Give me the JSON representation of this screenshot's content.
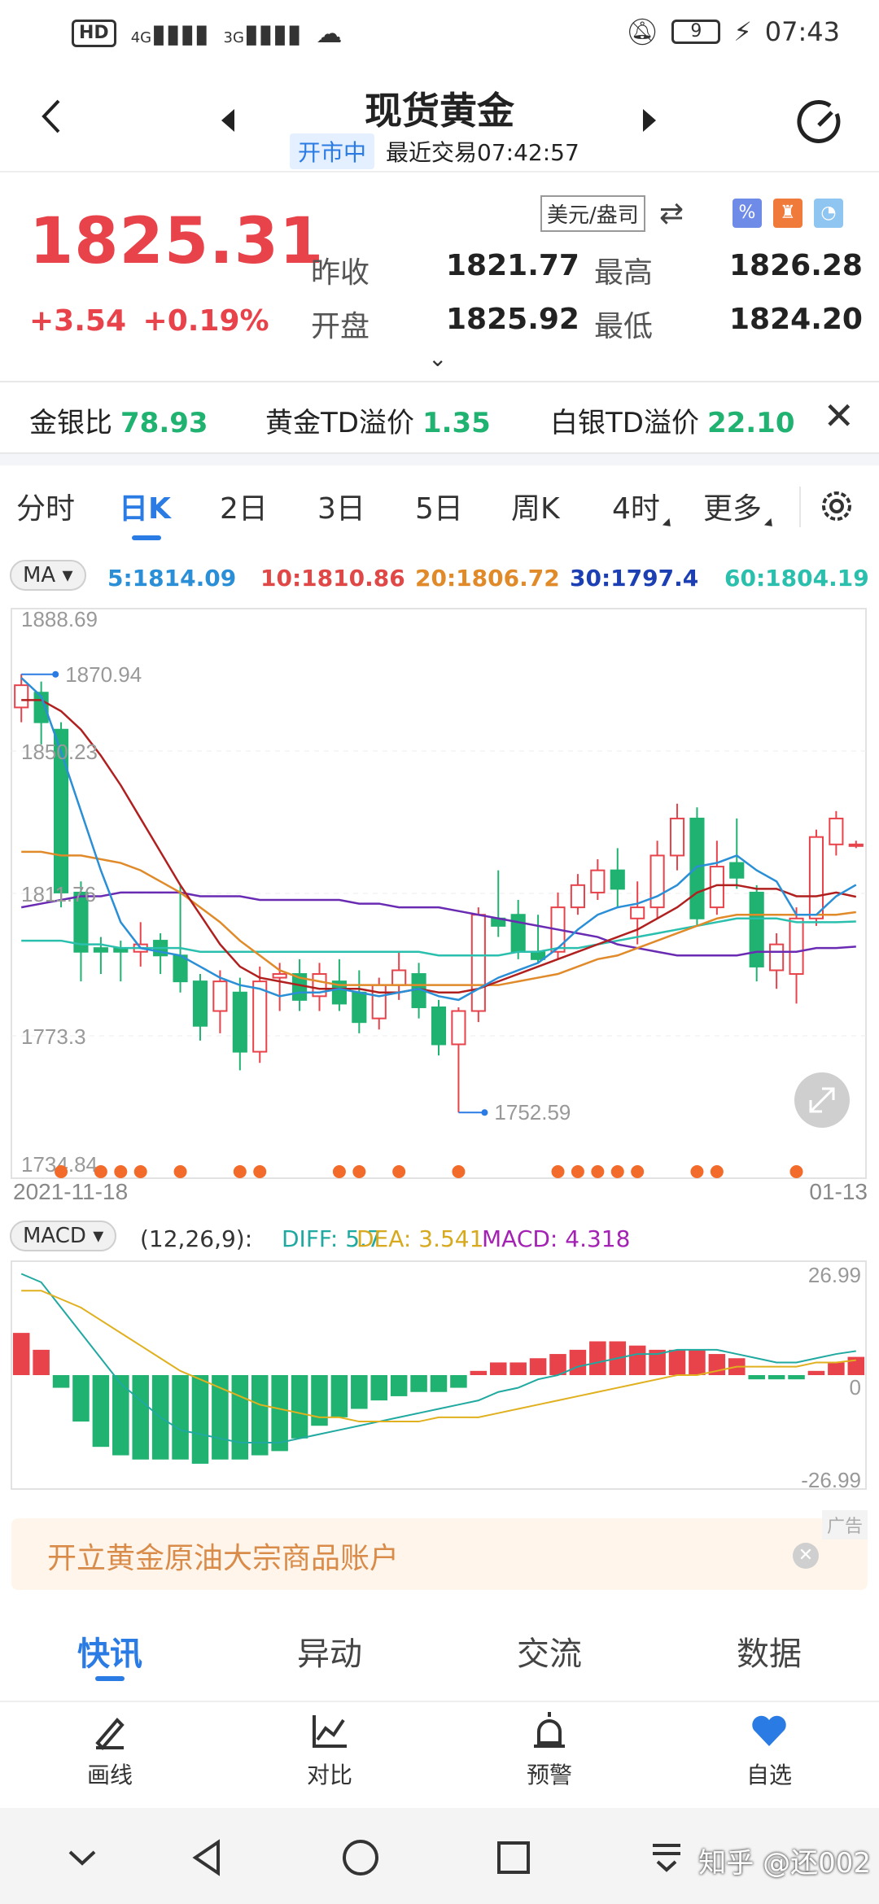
{
  "status": {
    "time": "07:43",
    "battery": "9",
    "net1": "4G",
    "net2": "3G",
    "hd": "HD"
  },
  "header": {
    "title": "现货黄金",
    "status_badge": "开市中",
    "last_trade": "最近交易07:42:57"
  },
  "quote": {
    "price": "1825.31",
    "change": "+3.54",
    "change_pct": "+0.19%",
    "prev_close_label": "昨收",
    "prev_close": "1821.77",
    "open_label": "开盘",
    "open": "1825.92",
    "high_label": "最高",
    "high": "1826.28",
    "low_label": "最低",
    "low": "1824.20",
    "unit": "美元/盎司"
  },
  "spreads": [
    {
      "label": "金银比",
      "value": "78.93"
    },
    {
      "label": "黄金TD溢价",
      "value": "1.35"
    },
    {
      "label": "白银TD溢价",
      "value": "22.10"
    }
  ],
  "tabs": [
    "分时",
    "日K",
    "2日",
    "3日",
    "5日",
    "周K",
    "4时",
    "更多"
  ],
  "active_tab": "日K",
  "ma_legend": {
    "selector": "MA",
    "ma5": "5:1814.09",
    "ma10": "10:1810.86",
    "ma20": "20:1806.72",
    "ma30": "30:1797.4",
    "ma60": "60:1804.19"
  },
  "colors": {
    "up": "#e8424a",
    "down": "#1fb270",
    "ma5": "#2a8fd6",
    "ma10": "#b0201f",
    "ma20": "#e08a2a",
    "ma30": "#6a2bb3",
    "ma60": "#2bbfae",
    "accent": "#2a7be4"
  },
  "chart_data": [
    {
      "type": "candlestick",
      "title": "",
      "ylim": [
        1734.84,
        1888.69
      ],
      "y_ticks": [
        "1888.69",
        "1850.23",
        "1811.76",
        "1773.3",
        "1734.84"
      ],
      "x_start": "2021-11-18",
      "x_end": "01-13",
      "max_label": "1870.94",
      "min_label": "1752.59",
      "candles": [
        {
          "o": 1862,
          "c": 1868,
          "h": 1871,
          "l": 1858
        },
        {
          "o": 1866,
          "c": 1858,
          "h": 1869,
          "l": 1852
        },
        {
          "o": 1856,
          "c": 1812,
          "h": 1858,
          "l": 1808
        },
        {
          "o": 1812,
          "c": 1796,
          "h": 1815,
          "l": 1788
        },
        {
          "o": 1797,
          "c": 1796,
          "h": 1800,
          "l": 1790
        },
        {
          "o": 1797,
          "c": 1796,
          "h": 1799,
          "l": 1788
        },
        {
          "o": 1796,
          "c": 1798,
          "h": 1804,
          "l": 1792
        },
        {
          "o": 1799,
          "c": 1795,
          "h": 1801,
          "l": 1790
        },
        {
          "o": 1795,
          "c": 1788,
          "h": 1814,
          "l": 1785
        },
        {
          "o": 1788,
          "c": 1776,
          "h": 1790,
          "l": 1772
        },
        {
          "o": 1780,
          "c": 1788,
          "h": 1791,
          "l": 1774
        },
        {
          "o": 1785,
          "c": 1769,
          "h": 1789,
          "l": 1764
        },
        {
          "o": 1769,
          "c": 1788,
          "h": 1792,
          "l": 1766
        },
        {
          "o": 1789,
          "c": 1790,
          "h": 1793,
          "l": 1780
        },
        {
          "o": 1790,
          "c": 1783,
          "h": 1794,
          "l": 1780
        },
        {
          "o": 1784,
          "c": 1790,
          "h": 1793,
          "l": 1780
        },
        {
          "o": 1788,
          "c": 1782,
          "h": 1794,
          "l": 1780
        },
        {
          "o": 1785,
          "c": 1777,
          "h": 1791,
          "l": 1774
        },
        {
          "o": 1778,
          "c": 1787,
          "h": 1789,
          "l": 1775
        },
        {
          "o": 1787,
          "c": 1791,
          "h": 1796,
          "l": 1783
        },
        {
          "o": 1790,
          "c": 1781,
          "h": 1793,
          "l": 1778
        },
        {
          "o": 1781,
          "c": 1771,
          "h": 1783,
          "l": 1768
        },
        {
          "o": 1771,
          "c": 1780,
          "h": 1781,
          "l": 1752.59
        },
        {
          "o": 1780,
          "c": 1806,
          "h": 1808,
          "l": 1777
        },
        {
          "o": 1805,
          "c": 1803,
          "h": 1818,
          "l": 1800
        },
        {
          "o": 1806,
          "c": 1796,
          "h": 1810,
          "l": 1794
        },
        {
          "o": 1796,
          "c": 1794,
          "h": 1806,
          "l": 1793
        },
        {
          "o": 1796,
          "c": 1808,
          "h": 1812,
          "l": 1794
        },
        {
          "o": 1808,
          "c": 1814,
          "h": 1817,
          "l": 1806
        },
        {
          "o": 1812,
          "c": 1818,
          "h": 1821,
          "l": 1810
        },
        {
          "o": 1818,
          "c": 1813,
          "h": 1824,
          "l": 1808
        },
        {
          "o": 1805,
          "c": 1808,
          "h": 1815,
          "l": 1798
        },
        {
          "o": 1808,
          "c": 1822,
          "h": 1826,
          "l": 1805
        },
        {
          "o": 1822,
          "c": 1832,
          "h": 1836,
          "l": 1818
        },
        {
          "o": 1832,
          "c": 1805,
          "h": 1835,
          "l": 1803
        },
        {
          "o": 1808,
          "c": 1819,
          "h": 1826,
          "l": 1806
        },
        {
          "o": 1820,
          "c": 1816,
          "h": 1832,
          "l": 1813
        },
        {
          "o": 1812,
          "c": 1792,
          "h": 1814,
          "l": 1788
        },
        {
          "o": 1791,
          "c": 1798,
          "h": 1801,
          "l": 1786
        },
        {
          "o": 1790,
          "c": 1805,
          "h": 1808,
          "l": 1782
        },
        {
          "o": 1805,
          "c": 1827,
          "h": 1829,
          "l": 1803
        },
        {
          "o": 1825,
          "c": 1832,
          "h": 1834,
          "l": 1822
        },
        {
          "o": 1825,
          "c": 1825,
          "h": 1826,
          "l": 1824
        }
      ],
      "ma_series": {
        "ma5": [
          1870,
          1865,
          1850,
          1834,
          1818,
          1804,
          1797,
          1796,
          1795,
          1792,
          1789,
          1787,
          1786,
          1784,
          1785,
          1785,
          1786,
          1785,
          1784,
          1785,
          1786,
          1784,
          1783,
          1786,
          1789,
          1791,
          1793,
          1797,
          1802,
          1806,
          1808,
          1809,
          1811,
          1814,
          1819,
          1820,
          1822,
          1818,
          1815,
          1806,
          1806,
          1811,
          1814.09
        ],
        "ma10": [
          1864,
          1864,
          1861,
          1856,
          1849,
          1841,
          1832,
          1823,
          1814,
          1806,
          1798,
          1792,
          1789,
          1788,
          1787,
          1786,
          1786,
          1786,
          1785,
          1785,
          1786,
          1785,
          1785,
          1786,
          1788,
          1790,
          1792,
          1794,
          1796,
          1798,
          1800,
          1802,
          1805,
          1808,
          1812,
          1814,
          1814,
          1813,
          1813,
          1811,
          1811,
          1812,
          1810.86
        ],
        "ma20": [
          1823,
          1823,
          1822,
          1822,
          1821,
          1820,
          1818,
          1815,
          1812,
          1808,
          1804,
          1799,
          1795,
          1791,
          1789,
          1788,
          1787,
          1787,
          1787,
          1787,
          1787,
          1787,
          1787,
          1787,
          1787,
          1788,
          1789,
          1790,
          1792,
          1794,
          1795,
          1797,
          1799,
          1801,
          1803,
          1805,
          1806,
          1806,
          1806,
          1806,
          1806,
          1806,
          1806.72
        ],
        "ma30": [
          1808,
          1809,
          1810,
          1811,
          1811,
          1812,
          1812,
          1812,
          1812,
          1811,
          1811,
          1811,
          1810,
          1810,
          1810,
          1810,
          1810,
          1809,
          1809,
          1808,
          1808,
          1808,
          1807,
          1806,
          1805,
          1804,
          1803,
          1802,
          1801,
          1800,
          1798,
          1797,
          1796,
          1795,
          1795,
          1795,
          1795,
          1796,
          1796,
          1796,
          1797,
          1797,
          1797.4
        ],
        "ma60": [
          1799,
          1799,
          1799,
          1798,
          1798,
          1797,
          1797,
          1797,
          1797,
          1796,
          1796,
          1796,
          1796,
          1796,
          1796,
          1796,
          1796,
          1796,
          1796,
          1796,
          1796,
          1795,
          1795,
          1795,
          1795,
          1796,
          1796,
          1797,
          1797,
          1798,
          1799,
          1800,
          1801,
          1802,
          1803,
          1804,
          1805,
          1805,
          1805,
          1804,
          1804,
          1804,
          1804.19
        ]
      },
      "event_markers": [
        2,
        4,
        5,
        6,
        8,
        11,
        12,
        16,
        17,
        19,
        22,
        27,
        28,
        29,
        30,
        31,
        34,
        35,
        39
      ]
    },
    {
      "type": "bar",
      "title": "MACD",
      "params": "(12,26,9):",
      "ylim": [
        -26.99,
        26.99
      ],
      "y_ticks": [
        "26.99",
        "0",
        "-26.99"
      ],
      "diff_label": "DIFF: 5.7",
      "dea_label": "DEA: 3.541",
      "macd_label": "MACD: 4.318",
      "histogram": [
        10,
        6,
        -3,
        -11,
        -17,
        -19,
        -20,
        -20,
        -20,
        -21,
        -20,
        -20,
        -19,
        -18,
        -15,
        -12,
        -10,
        -8,
        -6,
        -5,
        -4,
        -4,
        -3,
        1,
        3,
        3,
        4,
        5,
        6,
        8,
        8,
        7,
        6,
        6,
        6,
        5,
        4,
        -1,
        -1,
        -1,
        1,
        3,
        4.318
      ],
      "diff": [
        24,
        22,
        16,
        10,
        4,
        -2,
        -6,
        -10,
        -13,
        -14,
        -15,
        -16,
        -16,
        -16,
        -15,
        -14,
        -13,
        -12,
        -11,
        -10,
        -9,
        -8,
        -7,
        -6,
        -4,
        -3,
        -1,
        0,
        2,
        3,
        4,
        5,
        5,
        6,
        6,
        6,
        5,
        4,
        3,
        3,
        4,
        5,
        5.7
      ],
      "dea": [
        20,
        20,
        18,
        16,
        13,
        10,
        7,
        4,
        1,
        -1,
        -3,
        -5,
        -7,
        -8,
        -9,
        -10,
        -10,
        -11,
        -11,
        -11,
        -11,
        -10,
        -10,
        -10,
        -9,
        -8,
        -7,
        -6,
        -5,
        -4,
        -3,
        -2,
        -1,
        0,
        0,
        1,
        2,
        2,
        2,
        2,
        3,
        3,
        3.541
      ]
    }
  ],
  "content_tabs": [
    "快讯",
    "异动",
    "交流",
    "数据"
  ],
  "actions": [
    "画线",
    "对比",
    "预警",
    "自选"
  ],
  "ad": {
    "text": "开立黄金原油大宗商品账户",
    "tag": "广告"
  },
  "watermark": "知乎 @还002"
}
